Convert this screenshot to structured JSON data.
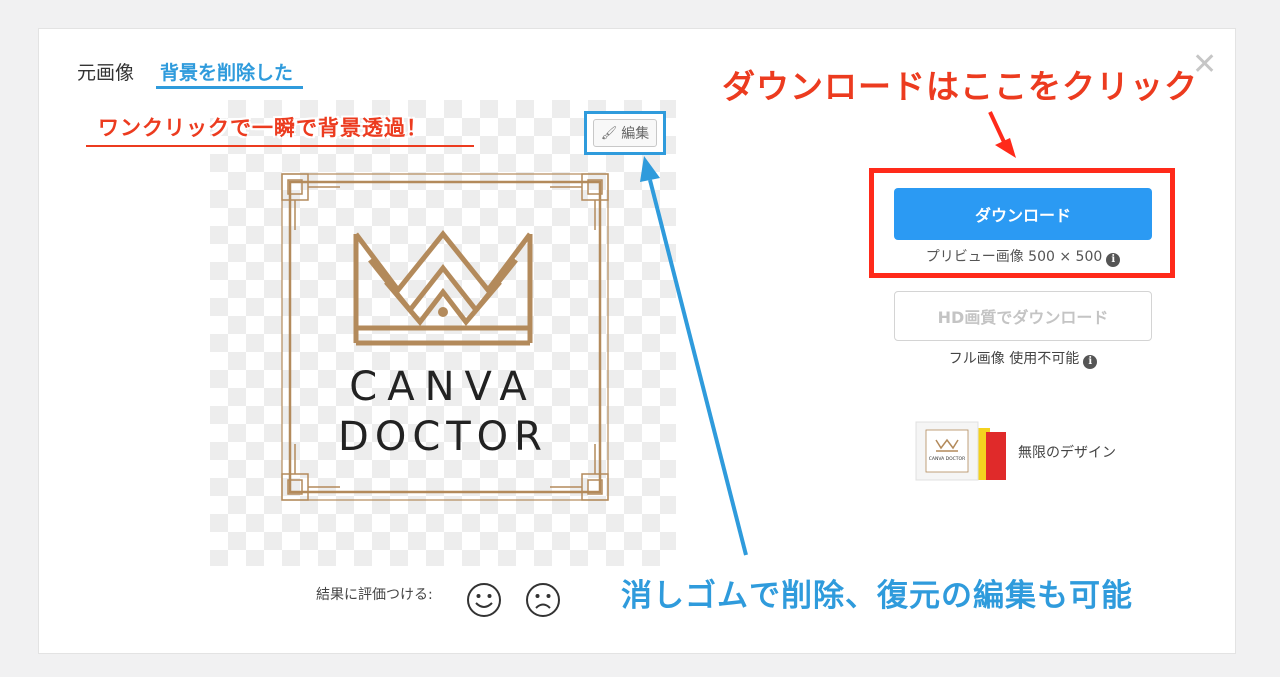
{
  "tabs": {
    "original": "元画像",
    "removed": "背景を削除した"
  },
  "editor": {
    "edit_label": "編集"
  },
  "logo": {
    "line1": "CANVA",
    "line2": "DOCTOR"
  },
  "download": {
    "button_label": "ダウンロード",
    "preview_info": "プリビュー画像 500 × 500",
    "hd_label": "HD画質でダウンロード",
    "full_info": "フル画像 使用不可能"
  },
  "promo": {
    "text": "無限のデザイン",
    "thumb_text": "CANVA DOCTOR"
  },
  "rating": {
    "label": "結果に評価つける:"
  },
  "annotations": {
    "top_left": "ワンクリックで一瞬で背景透過！",
    "download_hint": "ダウンロードはここをクリック",
    "eraser_hint": "消しゴムで削除、復元の編集も可能"
  },
  "colors": {
    "accent_blue": "#2f9bdc",
    "button_blue": "#2b9af3",
    "annotation_red": "#ec3b1f",
    "logo_gold": "#b38a5b"
  },
  "icons": {
    "close": "close-icon",
    "edit": "brush-icon",
    "info": "info-icon",
    "happy": "smile-face-icon",
    "sad": "sad-face-icon"
  }
}
